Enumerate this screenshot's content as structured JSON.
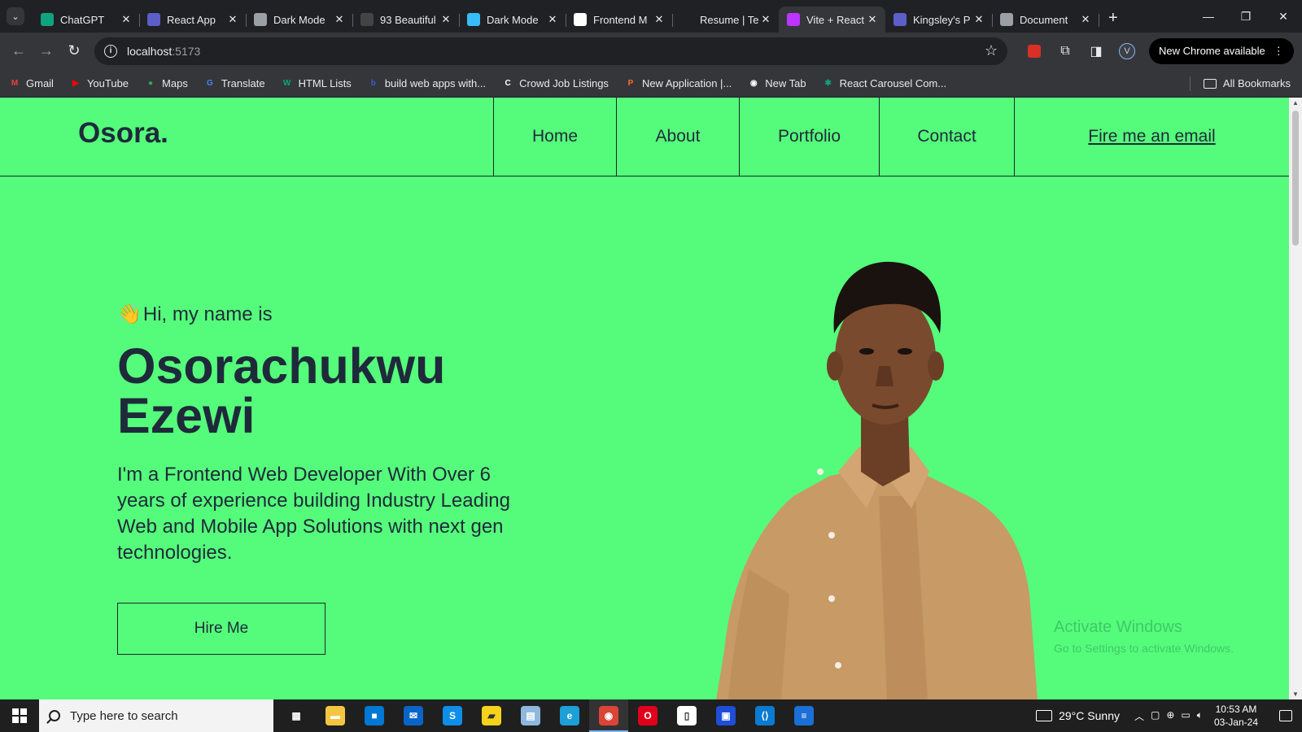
{
  "browser": {
    "tabs": [
      {
        "label": "ChatGPT",
        "favicon_color": "#10a37f",
        "active": false
      },
      {
        "label": "React App",
        "favicon_color": "#5b5fc7",
        "active": false
      },
      {
        "label": "Dark Mode",
        "favicon_color": "#9aa0a6",
        "active": false
      },
      {
        "label": "93 Beautiful",
        "favicon_color": "#444444",
        "active": false
      },
      {
        "label": "Dark Mode",
        "favicon_color": "#38bdf8",
        "active": false
      },
      {
        "label": "Frontend M",
        "favicon_color": "#ffffff",
        "active": false
      },
      {
        "label": "Resume | Te",
        "favicon_color": "#202124",
        "active": false
      },
      {
        "label": "Vite + React",
        "favicon_color": "#bd34fe",
        "active": true
      },
      {
        "label": "Kingsley's P",
        "favicon_color": "#5b5fc7",
        "active": false
      },
      {
        "label": "Document",
        "favicon_color": "#9aa0a6",
        "active": false
      }
    ],
    "new_tab_glyph": "+",
    "url_host": "localhost",
    "url_port": ":5173",
    "profile_initial": "V",
    "update_label": "New Chrome available",
    "bookmarks": [
      {
        "label": "Gmail",
        "icon": "gmail-icon",
        "color": "#ea4335",
        "glyph": "M"
      },
      {
        "label": "YouTube",
        "icon": "youtube-icon",
        "color": "#ff0000",
        "glyph": "▶"
      },
      {
        "label": "Maps",
        "icon": "maps-icon",
        "color": "#34a853",
        "glyph": "●"
      },
      {
        "label": "Translate",
        "icon": "translate-icon",
        "color": "#4285f4",
        "glyph": "G"
      },
      {
        "label": "HTML Lists",
        "icon": "w3schools-icon",
        "color": "#04aa6d",
        "glyph": "W"
      },
      {
        "label": "build web apps with...",
        "icon": "bolt-icon",
        "color": "#3b5bdb",
        "glyph": "b"
      },
      {
        "label": "Crowd Job Listings",
        "icon": "crowd-icon",
        "color": "#ffffff",
        "glyph": "C"
      },
      {
        "label": "New Application |...",
        "icon": "application-icon",
        "color": "#ff6b2c",
        "glyph": "P"
      },
      {
        "label": "New Tab",
        "icon": "globe-icon",
        "color": "#ffffff",
        "glyph": "◉"
      },
      {
        "label": "React Carousel Com...",
        "icon": "chatgpt-icon",
        "color": "#10a37f",
        "glyph": "✱"
      }
    ],
    "all_bookmarks_label": "All Bookmarks"
  },
  "site": {
    "logo": "Osora.",
    "nav": [
      {
        "label": "Home",
        "underline": false
      },
      {
        "label": "About",
        "underline": false
      },
      {
        "label": "Portfolio",
        "underline": false
      },
      {
        "label": "Contact",
        "underline": false
      },
      {
        "label": "Fire me an email",
        "underline": true
      }
    ],
    "greeting_emoji": "👋",
    "greeting": "Hi, my name is",
    "name_line1": "Osorachukwu",
    "name_line2": "Ezewi",
    "description": "I'm a Frontend Web Developer With Over 6 years of experience building Industry Leading Web and Mobile App Solutions with next gen technologies.",
    "cta": "Hire Me",
    "accent": "#55fc7b",
    "text_color": "#1e2a3a"
  },
  "watermark": {
    "line1": "Activate Windows",
    "line2": "Go to Settings to activate Windows."
  },
  "taskbar": {
    "search_placeholder": "Type here to search",
    "apps": [
      {
        "name": "task-view",
        "color": "#1f1f1f",
        "glyph": "▦"
      },
      {
        "name": "file-explorer",
        "color": "#f5c542",
        "glyph": "▬"
      },
      {
        "name": "ms-store",
        "color": "#0078d4",
        "glyph": "■"
      },
      {
        "name": "mail",
        "color": "#0a64c8",
        "glyph": "✉"
      },
      {
        "name": "skype",
        "color": "#0e8ee9",
        "glyph": "S"
      },
      {
        "name": "sticky-notes",
        "color": "#f7d21c",
        "glyph": "▰"
      },
      {
        "name": "notepad",
        "color": "#8fb8de",
        "glyph": "▤"
      },
      {
        "name": "edge",
        "color": "#1d9fd8",
        "glyph": "e"
      },
      {
        "name": "chrome",
        "color": "#db4437",
        "glyph": "◉",
        "active": true
      },
      {
        "name": "opera",
        "color": "#e0001b",
        "glyph": "O"
      },
      {
        "name": "file",
        "color": "#ffffff",
        "glyph": "▯"
      },
      {
        "name": "app",
        "color": "#1e4dd8",
        "glyph": "▣"
      },
      {
        "name": "vscode",
        "color": "#0b7ad1",
        "glyph": "⟨⟩"
      },
      {
        "name": "docs",
        "color": "#1b6fd6",
        "glyph": "≡"
      }
    ],
    "weather": "29°C  Sunny",
    "time": "10:53 AM",
    "date": "03-Jan-24"
  }
}
